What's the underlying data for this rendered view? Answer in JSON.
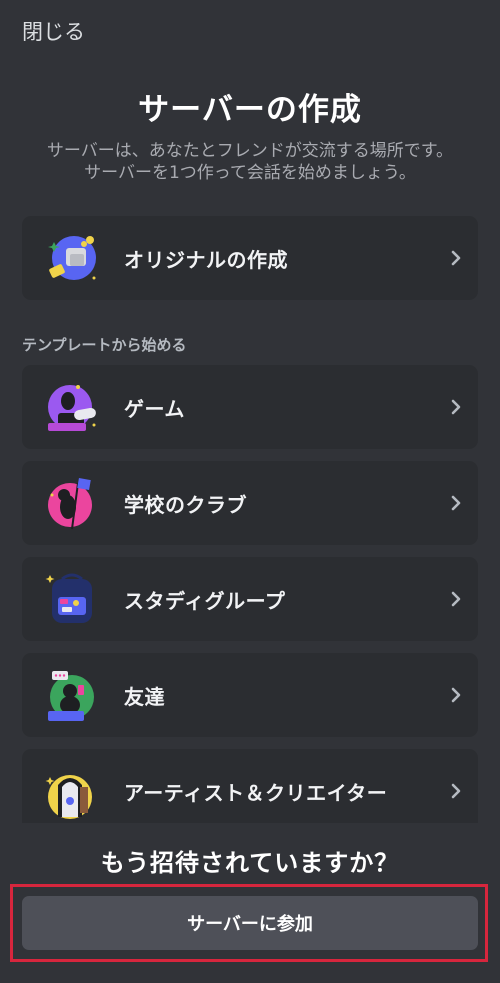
{
  "header": {
    "close_label": "閉じる"
  },
  "main": {
    "title": "サーバーの作成",
    "subtitle_line1": "サーバーは、あなたとフレンドが交流する場所です。",
    "subtitle_line2": "サーバーを1つ作って会話を始めましょう。",
    "create_own": {
      "label": "オリジナルの作成",
      "icon": "custom-server-icon"
    },
    "templates_heading": "テンプレートから始める",
    "templates": [
      {
        "label": "ゲーム",
        "icon": "gaming-icon"
      },
      {
        "label": "学校のクラブ",
        "icon": "school-club-icon"
      },
      {
        "label": "スタディグループ",
        "icon": "study-group-icon"
      },
      {
        "label": "友達",
        "icon": "friends-icon"
      },
      {
        "label": "アーティスト＆クリエイター",
        "icon": "artists-creators-icon"
      }
    ]
  },
  "footer": {
    "invited_question": "もう招待されていますか？",
    "join_label": "サーバーに参加"
  },
  "colors": {
    "background": "#313338",
    "card": "#2b2d31",
    "button": "#4e5058",
    "highlight_border": "#d7263d"
  }
}
